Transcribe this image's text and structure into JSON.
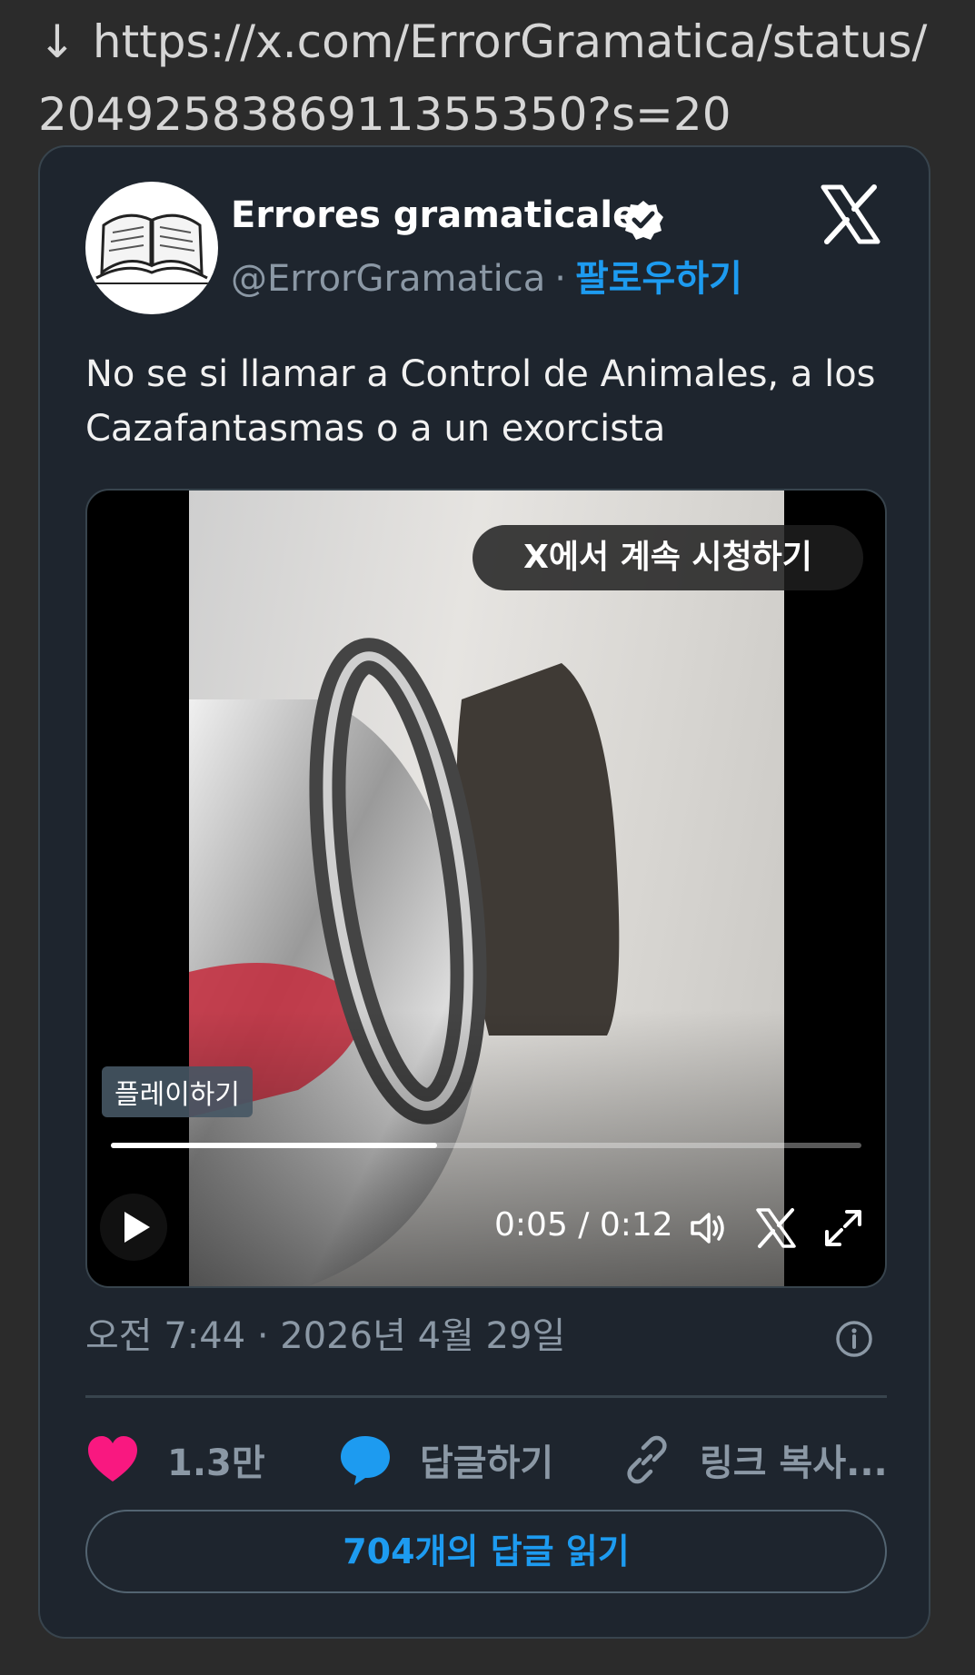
{
  "link": {
    "arrow": "↓",
    "url": "https://x.com/ErrorGramatica/status/2049258386911355350?s=20"
  },
  "tweet": {
    "display_name": "Errores gramaticales",
    "handle": "@ErrorGramatica",
    "separator": "·",
    "follow_label": "팔로우하기",
    "text": "No se si llamar a Control de Animales, a los Cazafantasmas o a un exorcista",
    "timestamp": "오전 7:44 · 2026년 4월 29일"
  },
  "video": {
    "watch_on_x": "X에서 계속 시청하기",
    "play_tooltip": "플레이하기",
    "time_display": "0:05 / 0:12",
    "progress": 0.435
  },
  "actions": {
    "likes": "1.3만",
    "reply_label": "답글하기",
    "copy_link_label": "링크 복사...",
    "read_replies_label": "704개의 답글 읽기"
  },
  "icons": [
    "book-avatar-icon",
    "verified-badge-icon",
    "x-logo-icon",
    "play-icon",
    "volume-icon",
    "x-small-icon",
    "fullscreen-icon",
    "info-icon",
    "heart-icon",
    "reply-bubble-icon",
    "link-icon"
  ],
  "colors": {
    "accent": "#1d9bf0",
    "like": "#f91880",
    "card_bg": "#1e252e",
    "page_bg": "#2b2b2b"
  }
}
